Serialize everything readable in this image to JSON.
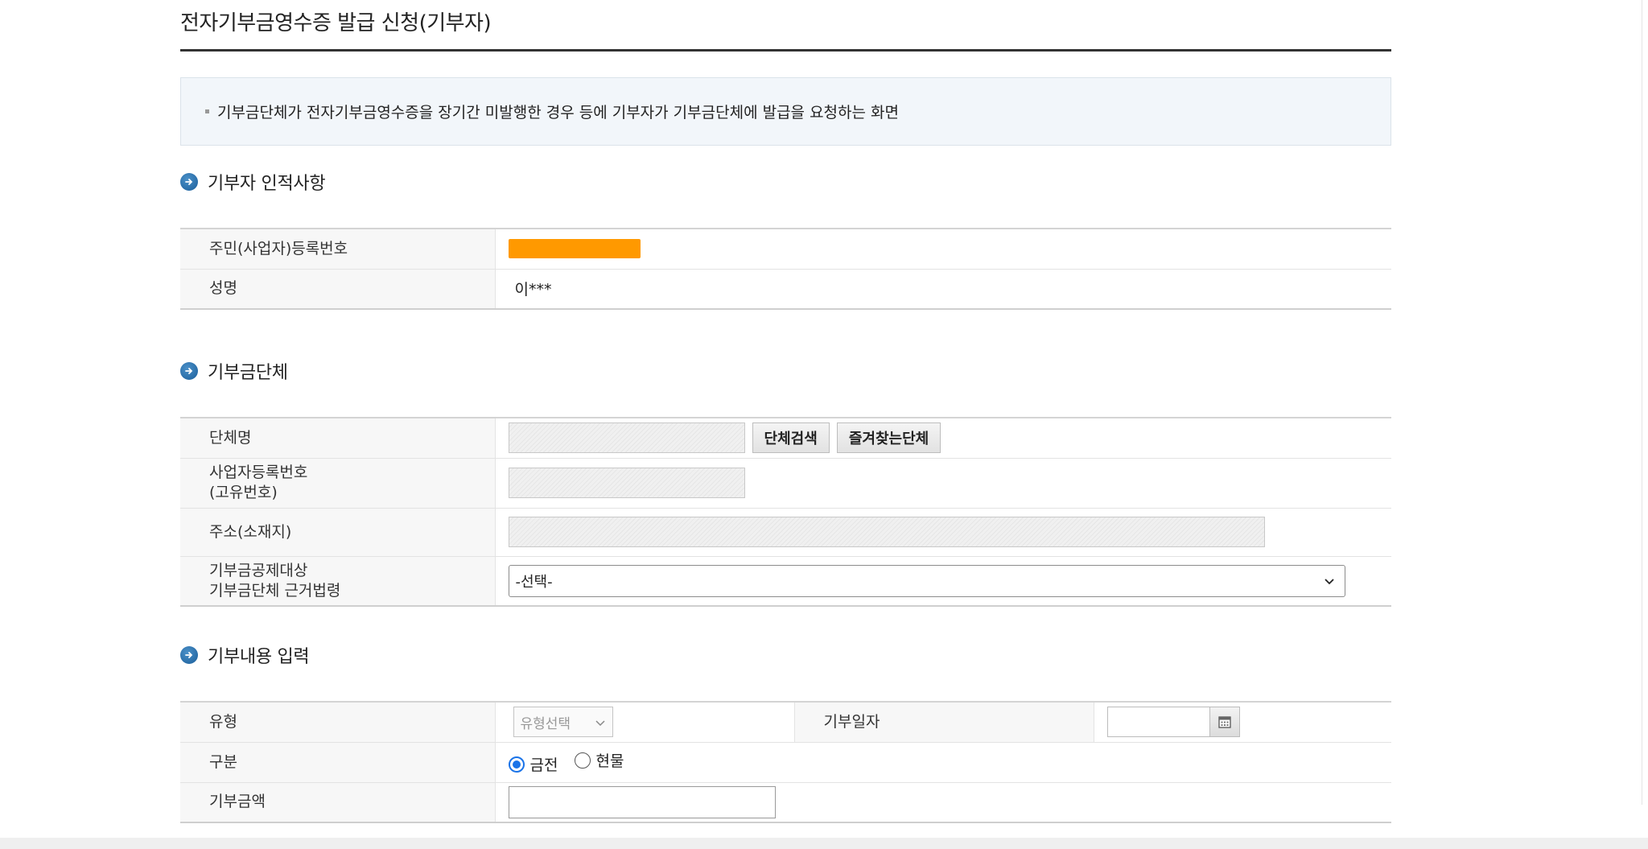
{
  "page": {
    "title": "전자기부금영수증 발급 신청(기부자)",
    "notice": "기부금단체가 전자기부금영수증을 장기간 미발행한 경우 등에 기부자가 기부금단체에 발급을 요청하는 화면"
  },
  "donor_section": {
    "title": "기부자 인적사항",
    "rows": [
      {
        "label": "주민(사업자)등록번호",
        "value": ""
      },
      {
        "label": "성명",
        "value": "이***"
      }
    ]
  },
  "org_section": {
    "title": "기부금단체",
    "org_name_label": "단체명",
    "search_button": "단체검색",
    "favorites_button": "즐겨찾는단체",
    "biz_no_label_line1": "사업자등록번호",
    "biz_no_label_line2": "(고유번호)",
    "address_label": "주소(소재지)",
    "law_label_line1": "기부금공제대상",
    "law_label_line2": "기부금단체 근거법령",
    "law_select_value": "-선택-"
  },
  "donation_section": {
    "title": "기부내용 입력",
    "type_label": "유형",
    "type_select_value": "유형선택",
    "date_label": "기부일자",
    "kind_label": "구분",
    "kind_options": [
      "금전",
      "현물"
    ],
    "kind_selected": "금전",
    "amount_label": "기부금액"
  },
  "colors": {
    "accent": "#1a73e8",
    "mask": "#ff9900",
    "section_icon": "#1b5e9a"
  },
  "icons": {
    "section": "arrow-circle-icon",
    "calendar": "calendar-icon",
    "dropdown": "chevron-down-icon"
  }
}
